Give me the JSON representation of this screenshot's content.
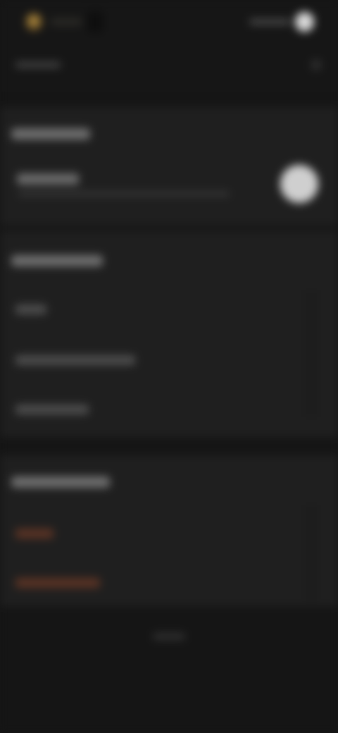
{
  "theme": {
    "background": "#151515",
    "card": "#1f1f1f",
    "accent": "#c9a24a",
    "danger_text": "#5a3324",
    "toggle_knob": "#d9d9d9"
  },
  "icons": {
    "logo": "app-logo-icon",
    "header_action": "chevron-right-icon",
    "toggle": "toggle-switch-icon"
  },
  "header": {
    "toggle_on": true
  },
  "section_1": {
    "toggle_on": true
  }
}
